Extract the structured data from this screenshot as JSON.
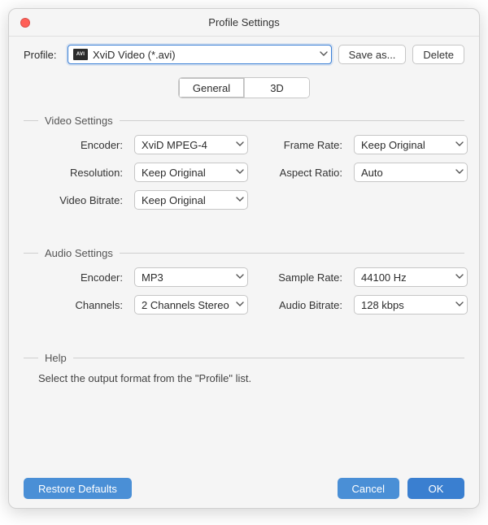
{
  "window": {
    "title": "Profile Settings"
  },
  "profile": {
    "label": "Profile:",
    "value": "XviD Video (*.avi)",
    "icon_text": "AVI",
    "save_as_label": "Save as...",
    "delete_label": "Delete"
  },
  "tabs": {
    "general": "General",
    "three_d": "3D",
    "active": "general"
  },
  "video": {
    "group_label": "Video Settings",
    "encoder_label": "Encoder:",
    "encoder_value": "XviD MPEG-4",
    "frame_rate_label": "Frame Rate:",
    "frame_rate_value": "Keep Original",
    "resolution_label": "Resolution:",
    "resolution_value": "Keep Original",
    "aspect_ratio_label": "Aspect Ratio:",
    "aspect_ratio_value": "Auto",
    "video_bitrate_label": "Video Bitrate:",
    "video_bitrate_value": "Keep Original"
  },
  "audio": {
    "group_label": "Audio Settings",
    "encoder_label": "Encoder:",
    "encoder_value": "MP3",
    "sample_rate_label": "Sample Rate:",
    "sample_rate_value": "44100 Hz",
    "channels_label": "Channels:",
    "channels_value": "2 Channels Stereo",
    "audio_bitrate_label": "Audio Bitrate:",
    "audio_bitrate_value": "128 kbps"
  },
  "help": {
    "group_label": "Help",
    "text": "Select the output format from the \"Profile\" list."
  },
  "footer": {
    "restore_label": "Restore Defaults",
    "cancel_label": "Cancel",
    "ok_label": "OK"
  }
}
